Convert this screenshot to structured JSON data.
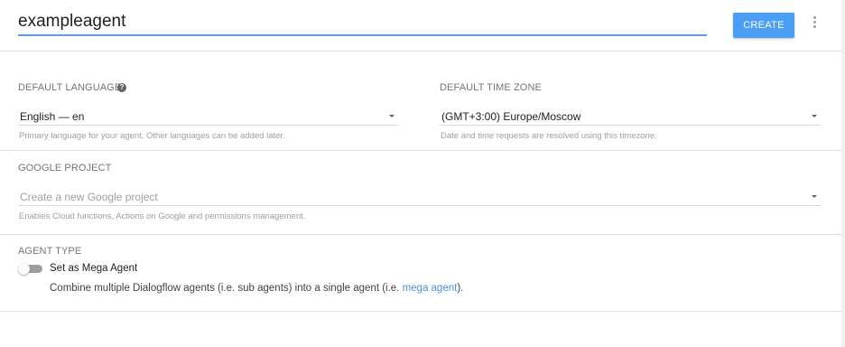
{
  "header": {
    "agent_name": "exampleagent",
    "create_label": "CREATE",
    "more_icon": "more-vert-icon"
  },
  "language": {
    "label": "DEFAULT LANGUAGE",
    "help_icon": "help-icon",
    "value": "English — en",
    "hint": "Primary language for your agent. Other languages can be added later."
  },
  "timezone": {
    "label": "DEFAULT TIME ZONE",
    "value": "(GMT+3:00) Europe/Moscow",
    "hint": "Date and time requests are resolved using this timezone."
  },
  "google_project": {
    "label": "GOOGLE PROJECT",
    "placeholder": "Create a new Google project",
    "hint": "Enables Cloud functions, Actions on Google and permissions management."
  },
  "agent_type": {
    "label": "AGENT TYPE",
    "toggle_label": "Set as Mega Agent",
    "toggle_on": false,
    "desc_prefix": "Combine multiple Dialogflow agents (i.e. sub agents) into a single agent (i.e. ",
    "desc_link": "mega agent",
    "desc_suffix": ")."
  },
  "colors": {
    "accent": "#4a9ff5",
    "link": "#4a90e2",
    "input_underline": "#5c9cf0"
  }
}
